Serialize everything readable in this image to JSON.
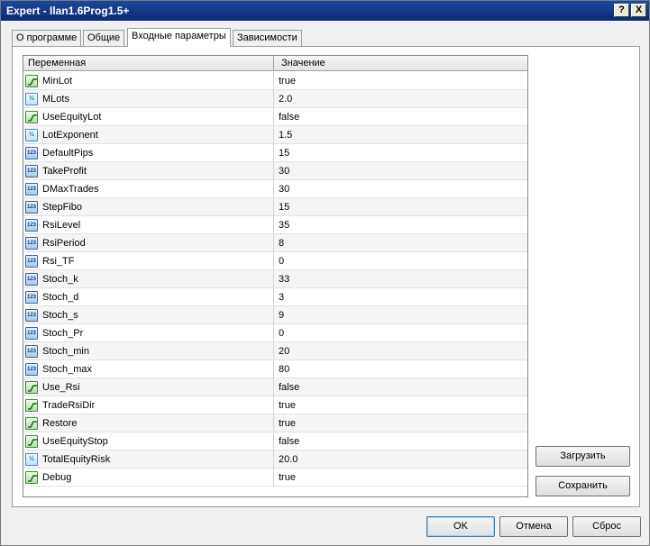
{
  "window": {
    "title": "Expert - Ilan1.6Prog1.5+"
  },
  "titlebar": {
    "help": "?",
    "close": "X"
  },
  "tabs": [
    {
      "label": "О программе"
    },
    {
      "label": "Общие"
    },
    {
      "label": "Входные параметры"
    },
    {
      "label": "Зависимости"
    }
  ],
  "table": {
    "headers": {
      "variable": "Переменная",
      "value": "Значение"
    },
    "rows": [
      {
        "type": "bool",
        "name": "MinLot",
        "value": "true"
      },
      {
        "type": "double",
        "name": "MLots",
        "value": "2.0"
      },
      {
        "type": "bool",
        "name": "UseEquityLot",
        "value": "false"
      },
      {
        "type": "double",
        "name": "LotExponent",
        "value": "1.5"
      },
      {
        "type": "int",
        "name": "DefaultPips",
        "value": "15"
      },
      {
        "type": "int",
        "name": "TakeProfit",
        "value": "30"
      },
      {
        "type": "int",
        "name": "DMaxTrades",
        "value": "30"
      },
      {
        "type": "int",
        "name": "StepFibo",
        "value": "15"
      },
      {
        "type": "int",
        "name": "RsiLevel",
        "value": "35"
      },
      {
        "type": "int",
        "name": "RsiPeriod",
        "value": "8"
      },
      {
        "type": "int",
        "name": "Rsi_TF",
        "value": "0"
      },
      {
        "type": "int",
        "name": "Stoch_k",
        "value": "33"
      },
      {
        "type": "int",
        "name": "Stoch_d",
        "value": "3"
      },
      {
        "type": "int",
        "name": "Stoch_s",
        "value": "9"
      },
      {
        "type": "int",
        "name": "Stoch_Pr",
        "value": "0"
      },
      {
        "type": "int",
        "name": "Stoch_min",
        "value": "20"
      },
      {
        "type": "int",
        "name": "Stoch_max",
        "value": "80"
      },
      {
        "type": "bool",
        "name": "Use_Rsi",
        "value": "false"
      },
      {
        "type": "bool",
        "name": "TradeRsiDir",
        "value": "true"
      },
      {
        "type": "bool",
        "name": "Restore",
        "value": "true"
      },
      {
        "type": "bool",
        "name": "UseEquityStop",
        "value": "false"
      },
      {
        "type": "double",
        "name": "TotalEquityRisk",
        "value": "20.0"
      },
      {
        "type": "bool",
        "name": "Debug",
        "value": "true"
      }
    ]
  },
  "icons": {
    "bool": "toggle-icon",
    "double": "fraction-icon",
    "int": "integer-icon"
  },
  "icon_text": {
    "double": "½",
    "int": "123"
  },
  "buttons": {
    "load": "Загрузить",
    "save": "Сохранить",
    "ok": "OK",
    "cancel": "Отмена",
    "reset": "Сброс"
  }
}
